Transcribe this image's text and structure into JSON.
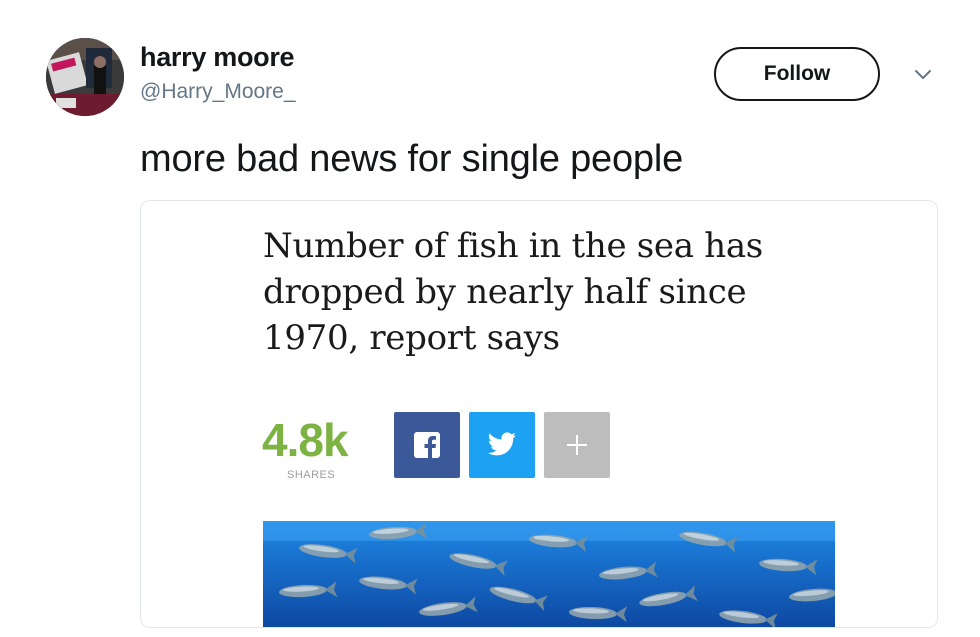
{
  "user": {
    "display_name": "harry moore",
    "handle": "@Harry_Moore_"
  },
  "actions": {
    "follow_label": "Follow"
  },
  "tweet": {
    "text": "more bad news for single people"
  },
  "card": {
    "headline": "Number of fish in the sea has dropped by nearly half since 1970, report says",
    "share_count": "4.8k",
    "shares_label": "SHARES",
    "share_buttons": [
      {
        "name": "facebook",
        "icon": "facebook-icon",
        "color": "#3b5998"
      },
      {
        "name": "twitter",
        "icon": "twitter-bird-icon",
        "color": "#1da1f2"
      },
      {
        "name": "more",
        "icon": "plus-icon",
        "color": "#bdbdbd"
      }
    ],
    "image": {
      "subject": "school of tuna fish in blue ocean water"
    }
  },
  "colors": {
    "share_count": "#7cb342",
    "handle": "#657786",
    "text": "#14171a"
  }
}
